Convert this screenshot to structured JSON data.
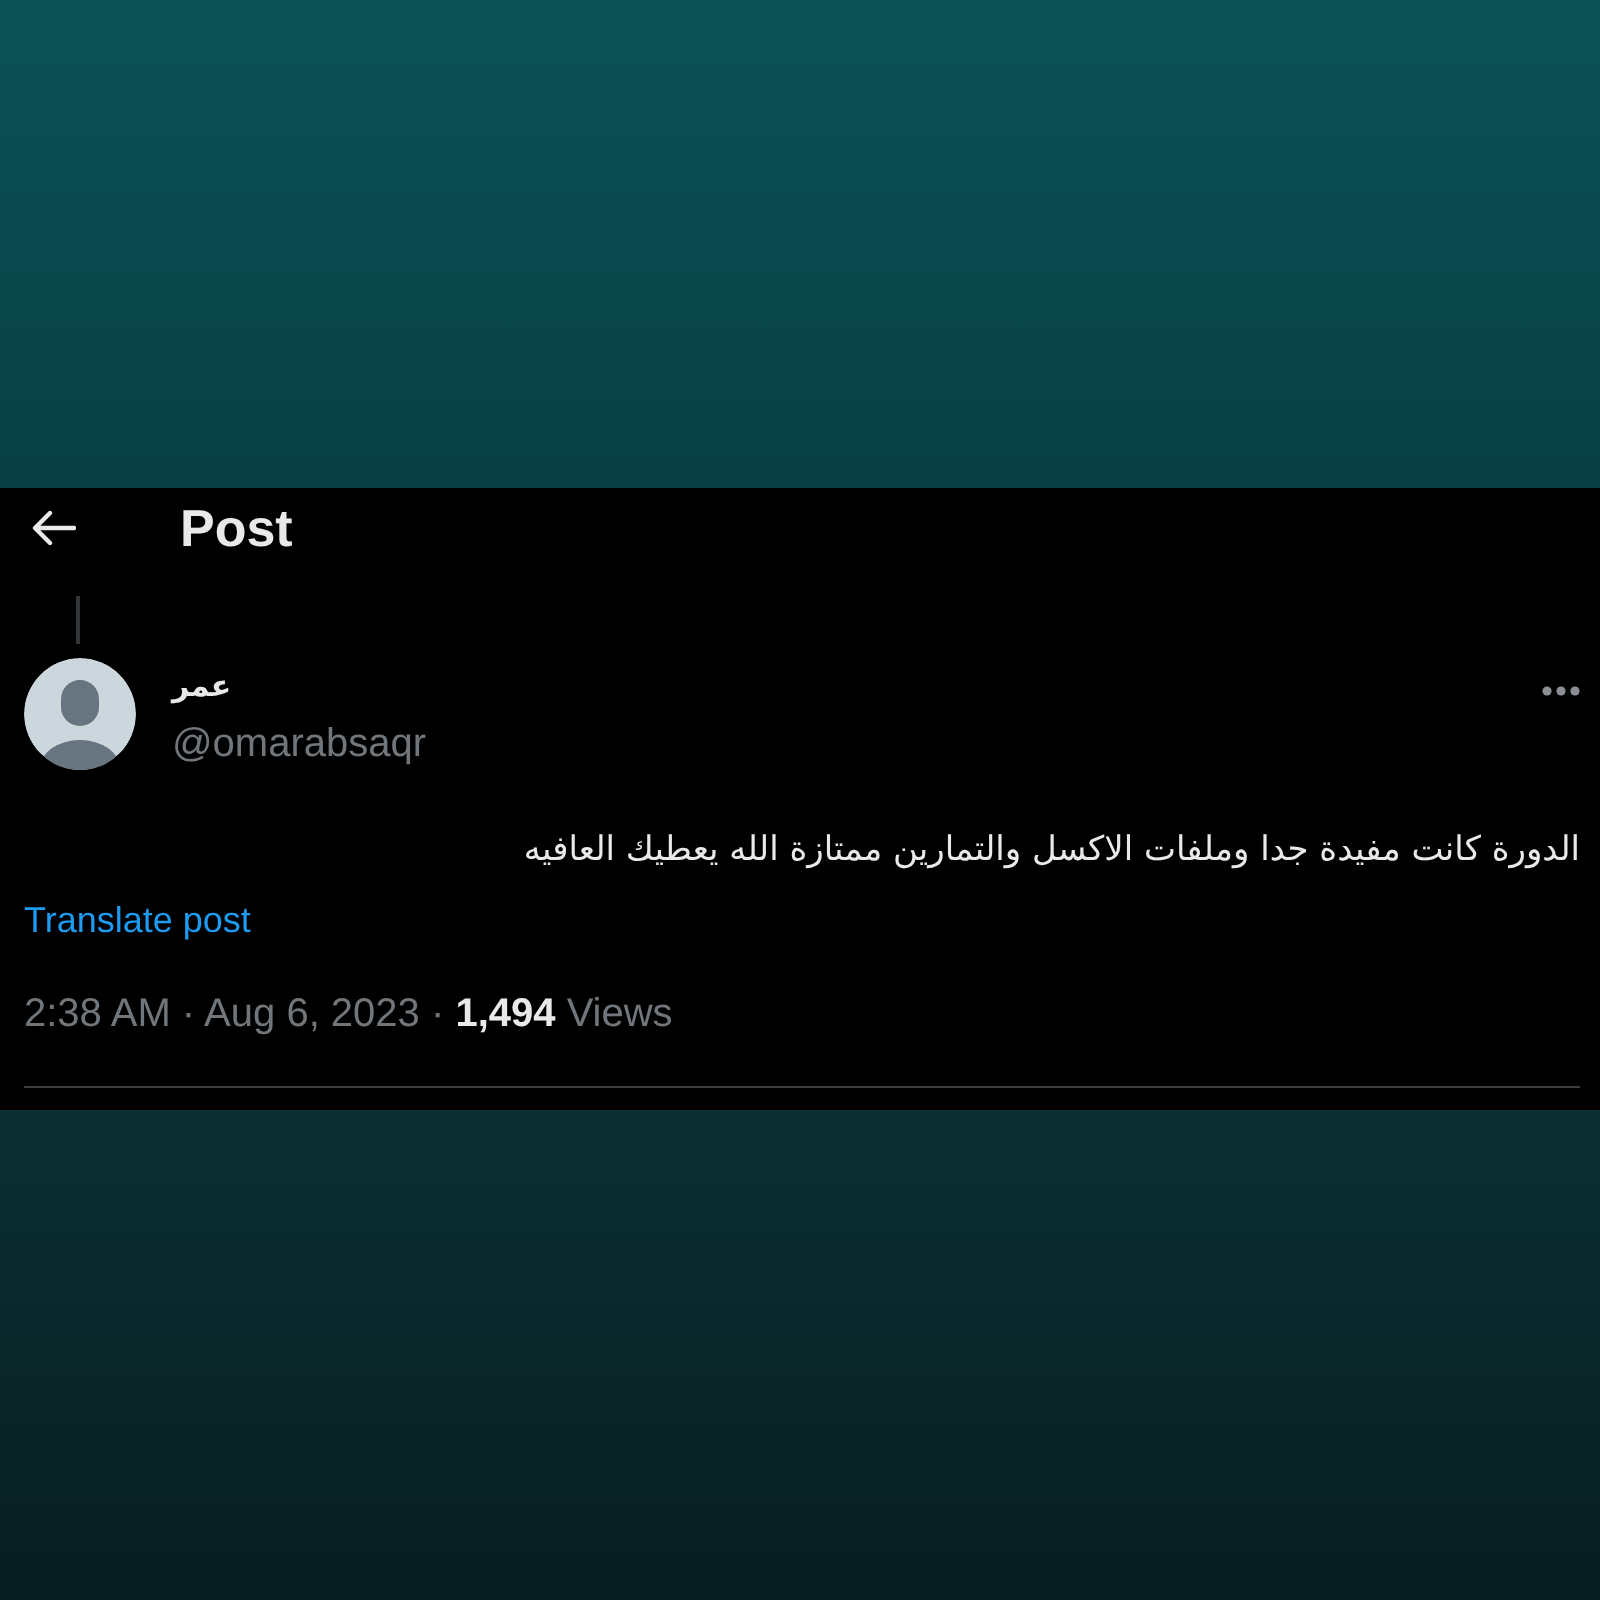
{
  "header": {
    "title": "Post"
  },
  "post": {
    "author": {
      "name": "عمر",
      "handle": "@omarabsaqr"
    },
    "text": "الدورة كانت مفيدة جدا وملفات الاكسل والتمارين ممتازة  الله يعطيك العافيه",
    "translate_link": "Translate post",
    "meta": "2:38 AM · Aug 6, 2023 · **1,494** Views"
  }
}
